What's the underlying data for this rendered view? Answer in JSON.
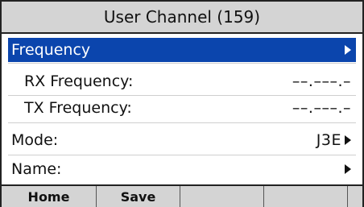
{
  "title": "User Channel (159)",
  "menu": {
    "frequency": {
      "label": "Frequency",
      "icon": "arrow-right-icon"
    },
    "rx_frequency": {
      "label": "RX Frequency:",
      "value": "––.–––.–"
    },
    "tx_frequency": {
      "label": "TX Frequency:",
      "value": "––.–––.–"
    },
    "mode": {
      "label": "Mode:",
      "value": "J3E",
      "icon": "arrow-right-icon"
    },
    "name": {
      "label": "Name:",
      "value": "",
      "icon": "arrow-right-icon"
    }
  },
  "softkeys": [
    "Home",
    "Save",
    "",
    "",
    ""
  ],
  "colors": {
    "selection": "#0b45ad",
    "bar_background": "#d4d4d4",
    "border": "#222222"
  }
}
